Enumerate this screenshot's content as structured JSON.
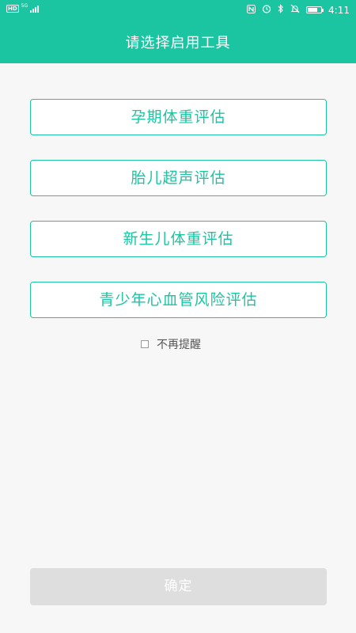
{
  "status_bar": {
    "hd_label": "HD",
    "network_label": "5G",
    "time": "4:11",
    "icons": [
      "nfc-icon",
      "alarm-icon",
      "bluetooth-icon",
      "mute-icon",
      "battery-icon"
    ]
  },
  "header": {
    "title": "请选择启用工具",
    "background_color": "#1bc5a1"
  },
  "tools": [
    {
      "label": "孕期体重评估"
    },
    {
      "label": "胎儿超声评估"
    },
    {
      "label": "新生儿体重评估"
    },
    {
      "label": "青少年心血管风险评估"
    }
  ],
  "remind": {
    "label": "不再提醒",
    "checked": false
  },
  "confirm": {
    "label": "确定",
    "enabled": false
  },
  "colors": {
    "accent": "#1bc5a1",
    "disabled_button": "#dedede",
    "page_background": "#f7f7f7"
  }
}
